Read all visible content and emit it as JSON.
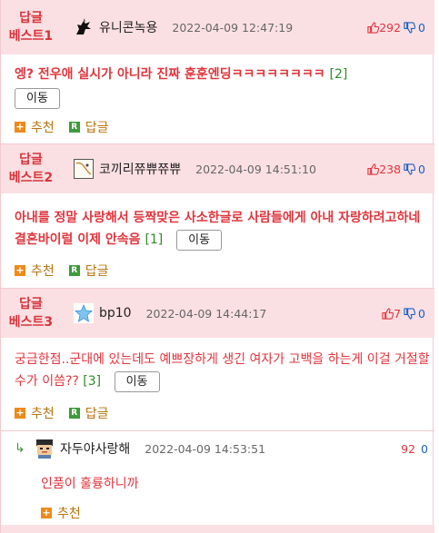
{
  "comments": [
    {
      "badge_line1": "답글",
      "badge_line2": "베스트1",
      "avatar_icon": "unicorn-icon",
      "nickname": "유니콘녹용",
      "date": "2022-04-09 12:47:19",
      "upvotes": "292",
      "downvotes": "0",
      "text": "엥? 전우애 실시가 아니라 진짜 훈훈엔딩ㅋㅋㅋㅋㅋㅋㅋㅋ",
      "reply_count": "[2]",
      "move_label": "이동",
      "recommend_label": "추천",
      "reply_label": "답글"
    },
    {
      "badge_line1": "답글",
      "badge_line2": "베스트2",
      "avatar_icon": "drawing-avatar-icon",
      "nickname": "코끼리쮸쀼쮸쀼",
      "date": "2022-04-09 14:51:10",
      "upvotes": "238",
      "downvotes": "0",
      "text": "아내를 정말 사랑해서 등짝맞은 사소한글로 사람들에게 아내 자랑하려고하네 결혼바이럴 이제 안속음",
      "reply_count": "[1]",
      "move_label": "이동",
      "recommend_label": "추천",
      "reply_label": "답글"
    },
    {
      "badge_line1": "답글",
      "badge_line2": "베스트3",
      "avatar_icon": "blue-star-icon",
      "nickname": "bp10",
      "date": "2022-04-09 14:44:17",
      "upvotes": "7",
      "downvotes": "0",
      "text": "궁금한점..군대에 있는데도 예쁘장하게 생긴 여자가 고백을 하는게 이걸 거절할 수가 이씀??",
      "reply_count": "[3]",
      "move_label": "이동",
      "recommend_label": "추천",
      "reply_label": "답글"
    }
  ],
  "reply": {
    "nickname": "자두야사랑해",
    "date": "2022-04-09 14:53:51",
    "upvotes": "92",
    "downvotes": "0",
    "text": "인품이 훌륭하니까",
    "recommend_label": "추천"
  },
  "colors": {
    "best_bg": "#fbe0e3",
    "accent_red": "#e0353d",
    "down_blue": "#1860c5",
    "count_green": "#2f8a2a"
  }
}
